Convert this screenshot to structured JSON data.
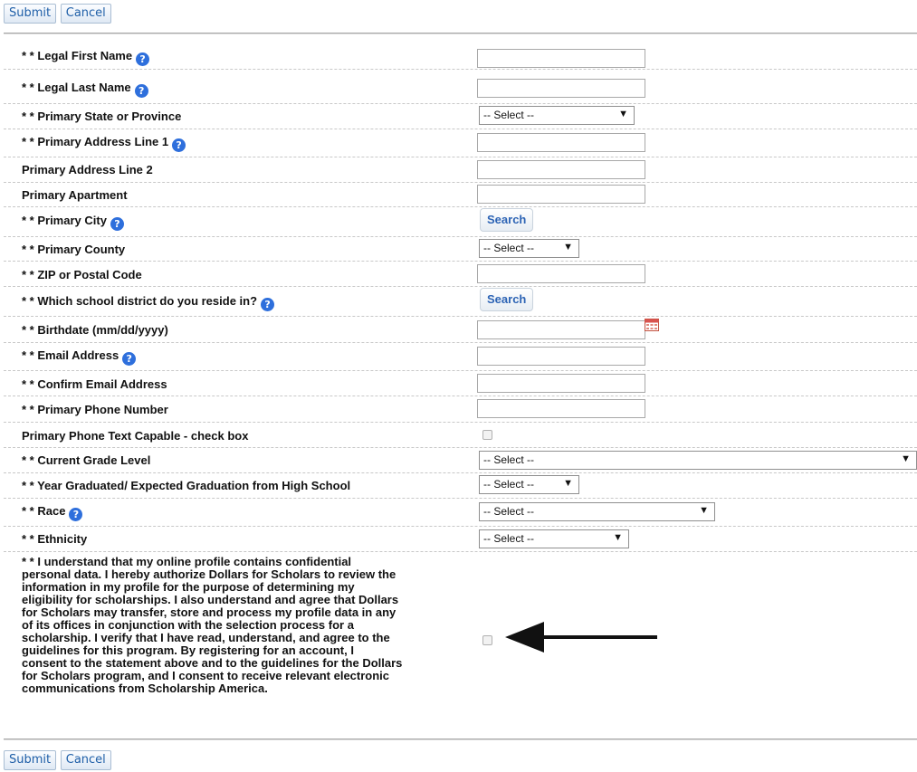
{
  "buttons": {
    "submit": "Submit",
    "cancel": "Cancel",
    "search": "Search"
  },
  "help_glyph": "?",
  "fields": {
    "legal_first_name": {
      "label": "* * Legal First Name",
      "value": ""
    },
    "legal_last_name": {
      "label": "* * Legal Last Name",
      "value": ""
    },
    "primary_state": {
      "label": "* * Primary State or Province",
      "selected": "-- Select --"
    },
    "primary_address_1": {
      "label": "* * Primary Address Line 1",
      "value": ""
    },
    "primary_address_2": {
      "label": "Primary Address Line 2",
      "value": ""
    },
    "primary_apartment": {
      "label": "Primary Apartment",
      "value": ""
    },
    "primary_city": {
      "label": "* * Primary City"
    },
    "primary_county": {
      "label": "* * Primary County",
      "selected": "-- Select --"
    },
    "zip": {
      "label": "* * ZIP or Postal Code",
      "value": ""
    },
    "school_district": {
      "label": "* * Which school district do you reside in?"
    },
    "birthdate": {
      "label": "* * Birthdate (mm/dd/yyyy)",
      "value": ""
    },
    "email": {
      "label": "* * Email Address",
      "value": ""
    },
    "confirm_email": {
      "label": "* * Confirm Email Address",
      "value": ""
    },
    "phone": {
      "label": "* * Primary Phone Number",
      "value": ""
    },
    "phone_text": {
      "label": "Primary Phone Text Capable - check box",
      "checked": false
    },
    "grade_level": {
      "label": "* * Current Grade Level",
      "selected": "-- Select --"
    },
    "graduation_year": {
      "label": "* * Year Graduated/ Expected Graduation from High School",
      "selected": "-- Select --"
    },
    "race": {
      "label": "* * Race",
      "selected": "-- Select --"
    },
    "ethnicity": {
      "label": "* * Ethnicity",
      "selected": "-- Select --"
    },
    "consent": {
      "text": "* * I understand that my online profile contains confidential\npersonal data. I hereby authorize Dollars for Scholars to review the\ninformation in my profile for the purpose of determining my\neligibility for scholarships. I also understand and agree that Dollars\nfor Scholars may transfer, store and process my profile data in any\nof its offices in conjunction with the selection process for a\nscholarship. I verify that I have read, understand, and agree to the\nguidelines for this program. By registering for an account, I\nconsent to the statement above and to the guidelines for the Dollars\nfor Scholars program, and I consent to receive relevant electronic\ncommunications from Scholarship America.",
      "checked": false
    }
  },
  "icons": {
    "help": "help-circle-icon",
    "dropdown": "caret-down-icon",
    "calendar": "calendar-icon",
    "annotation": "arrow-left-icon"
  },
  "colors": {
    "help_icon": "#2e6fdc",
    "button_text": "#1f5fa8",
    "search_text": "#2d64b5"
  }
}
